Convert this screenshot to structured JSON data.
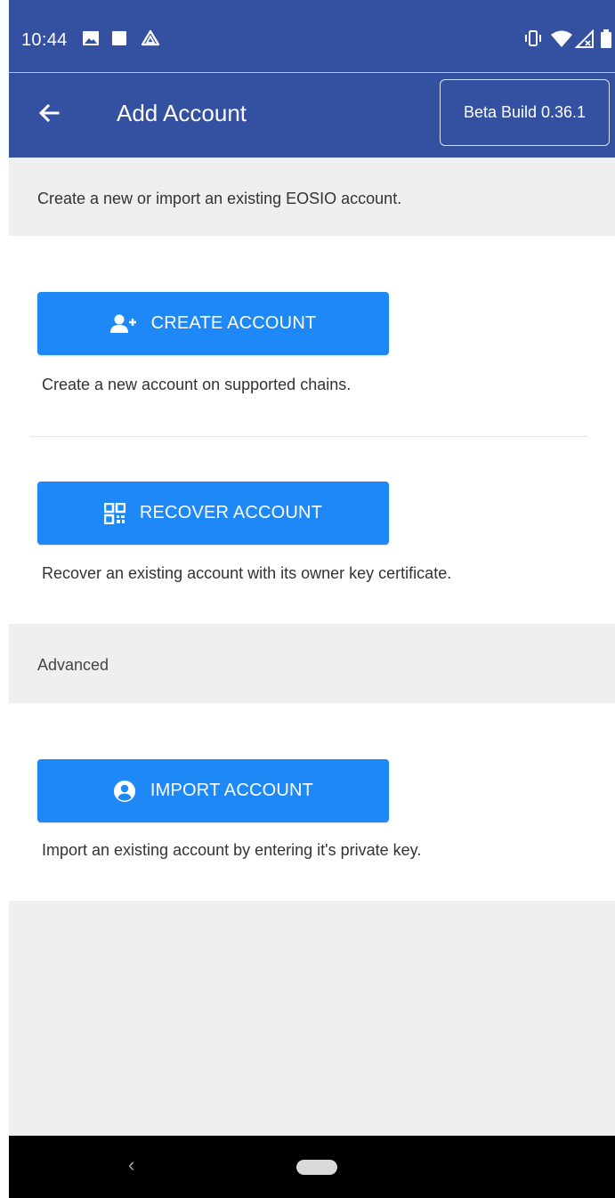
{
  "status_bar": {
    "time": "10:44",
    "icons": [
      "image-icon",
      "square-icon",
      "drive-icon",
      "vibrate-icon",
      "wifi-icon",
      "no-signal-icon",
      "battery-icon"
    ]
  },
  "app_bar": {
    "title": "Add Account",
    "back_icon": "arrow-left-icon",
    "beta_label": "Beta Build 0.36.1"
  },
  "intro": {
    "text": "Create a new or import an existing EOSIO account."
  },
  "create": {
    "button_label": "CREATE ACCOUNT",
    "icon": "add-person-icon",
    "description": "Create a new account on supported chains."
  },
  "recover": {
    "button_label": "RECOVER ACCOUNT",
    "icon": "qr-code-icon",
    "description": "Recover an existing account with its owner key certificate."
  },
  "advanced": {
    "header": "Advanced"
  },
  "import": {
    "button_label": "IMPORT ACCOUNT",
    "icon": "account-circle-icon",
    "description": "Import an existing account by entering it's private key."
  },
  "nav_bar": {
    "back_glyph": "‹"
  },
  "colors": {
    "app_bar": "#3350a1",
    "button": "#1e88f6",
    "background": "#efefef"
  }
}
